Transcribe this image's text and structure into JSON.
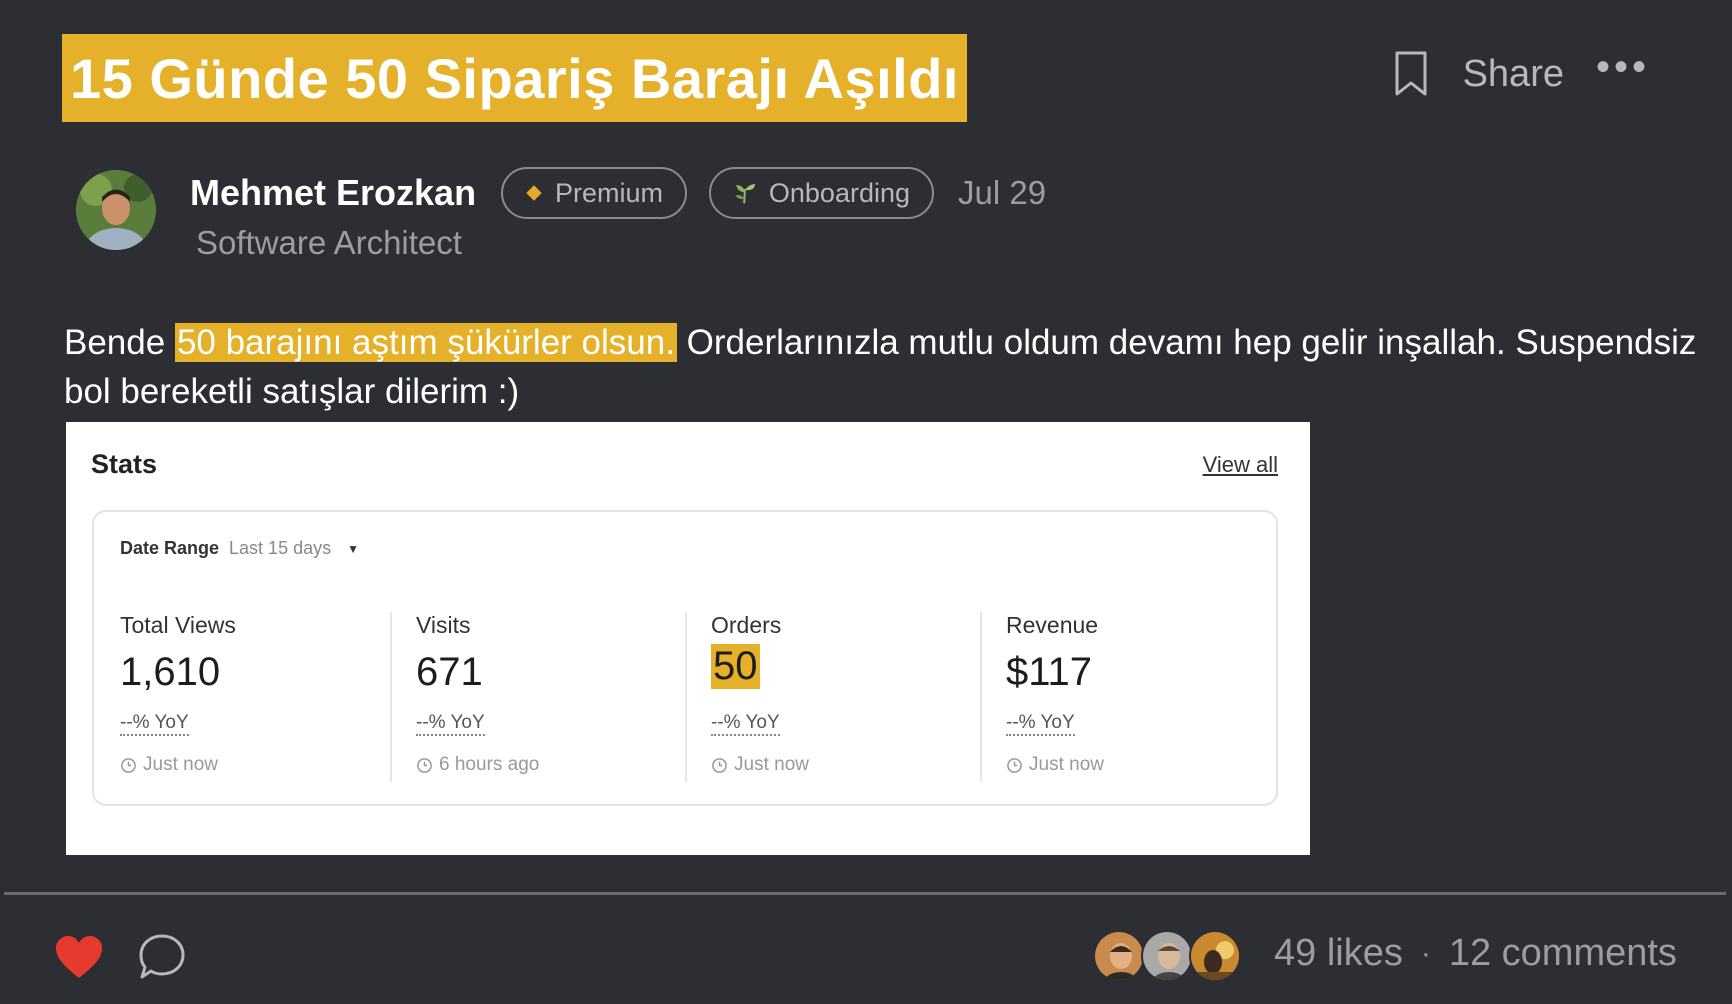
{
  "post": {
    "title": "15 Günde 50 Sipariş Barajı Aşıldı",
    "actions": {
      "bookmark_icon": "bookmark-icon",
      "share_label": "Share",
      "more_icon": "•••"
    },
    "author": {
      "name": "Mehmet Erozkan",
      "role": "Software Architect"
    },
    "badges": {
      "premium": "Premium",
      "onboarding": "Onboarding"
    },
    "date": "Jul 29",
    "body": {
      "before": "Bende ",
      "highlight": "50 barajını aştım şükürler olsun.",
      "after": " Orderlarınızla mutlu oldum devamı hep gelir inşallah. Suspendsiz bol bereketli satışlar dilerim :)"
    },
    "footer": {
      "likes": "49 likes",
      "separator": "·",
      "comments": "12 comments"
    }
  },
  "stats_card": {
    "title": "Stats",
    "view_all": "View all",
    "date_range_label": "Date Range",
    "date_range_value": "Last 15 days",
    "metrics": [
      {
        "label": "Total Views",
        "value": "1,610",
        "yoy": "--% YoY",
        "time": "Just now"
      },
      {
        "label": "Visits",
        "value": "671",
        "yoy": "--% YoY",
        "time": "6 hours ago"
      },
      {
        "label": "Orders",
        "value": "50",
        "yoy": "--% YoY",
        "time": "Just now"
      },
      {
        "label": "Revenue",
        "value": "$117",
        "yoy": "--% YoY",
        "time": "Just now"
      }
    ]
  },
  "colors": {
    "background": "#2d2e33",
    "highlight": "#e6b12a",
    "heart": "#e63a2e",
    "muted_text": "#9c9da2"
  }
}
